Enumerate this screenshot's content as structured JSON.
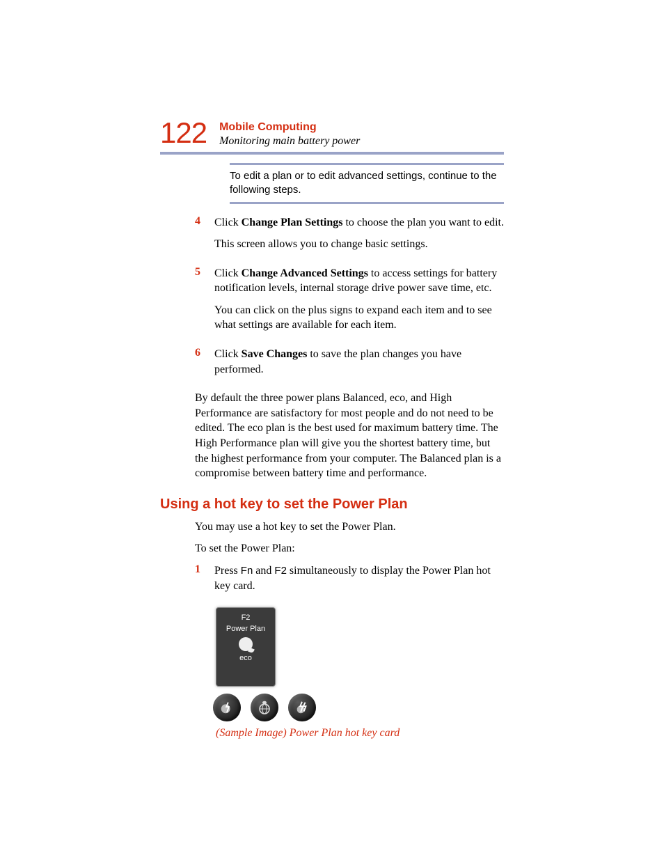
{
  "header": {
    "page_number": "122",
    "chapter": "Mobile Computing",
    "section": "Monitoring main battery power"
  },
  "callout": {
    "text": "To edit a plan or to edit advanced settings, continue to the following steps."
  },
  "steps_a": [
    {
      "num": "4",
      "lines": [
        {
          "prefix": "Click ",
          "bold": "Change Plan Settings",
          "suffix": " to choose the plan you want to edit."
        },
        {
          "prefix": "This screen allows you to change basic settings.",
          "bold": "",
          "suffix": ""
        }
      ]
    },
    {
      "num": "5",
      "lines": [
        {
          "prefix": "Click ",
          "bold": "Change Advanced Settings",
          "suffix": " to access settings for battery notification levels, internal storage drive power save time, etc."
        },
        {
          "prefix": "You can click on the plus signs to expand each item and to see what settings are available for each item.",
          "bold": "",
          "suffix": ""
        }
      ]
    },
    {
      "num": "6",
      "lines": [
        {
          "prefix": "Click ",
          "bold": "Save Changes",
          "suffix": " to save the plan changes you have performed."
        }
      ]
    }
  ],
  "body_para_1": "By default the three power plans Balanced, eco, and High Performance are satisfactory for most people and do not need to be edited. The eco plan is the best used for maximum battery time. The High Performance plan will give you the shortest battery time, but the highest performance from your computer. The Balanced plan is a compromise between battery time and performance.",
  "heading_2": "Using a hot key to set the Power Plan",
  "body_para_2": "You may use a hot key to set the Power Plan.",
  "body_para_3": "To set the Power Plan:",
  "steps_b": [
    {
      "num": "1",
      "line": {
        "prefix": "Press ",
        "key1": "Fn",
        "mid": " and ",
        "key2": "F2",
        "suffix": " simultaneously to display the Power Plan hot key card."
      }
    }
  ],
  "card": {
    "key": "F2",
    "title": "Power Plan",
    "mode": "eco"
  },
  "caption": "(Sample Image) Power Plan hot key card"
}
